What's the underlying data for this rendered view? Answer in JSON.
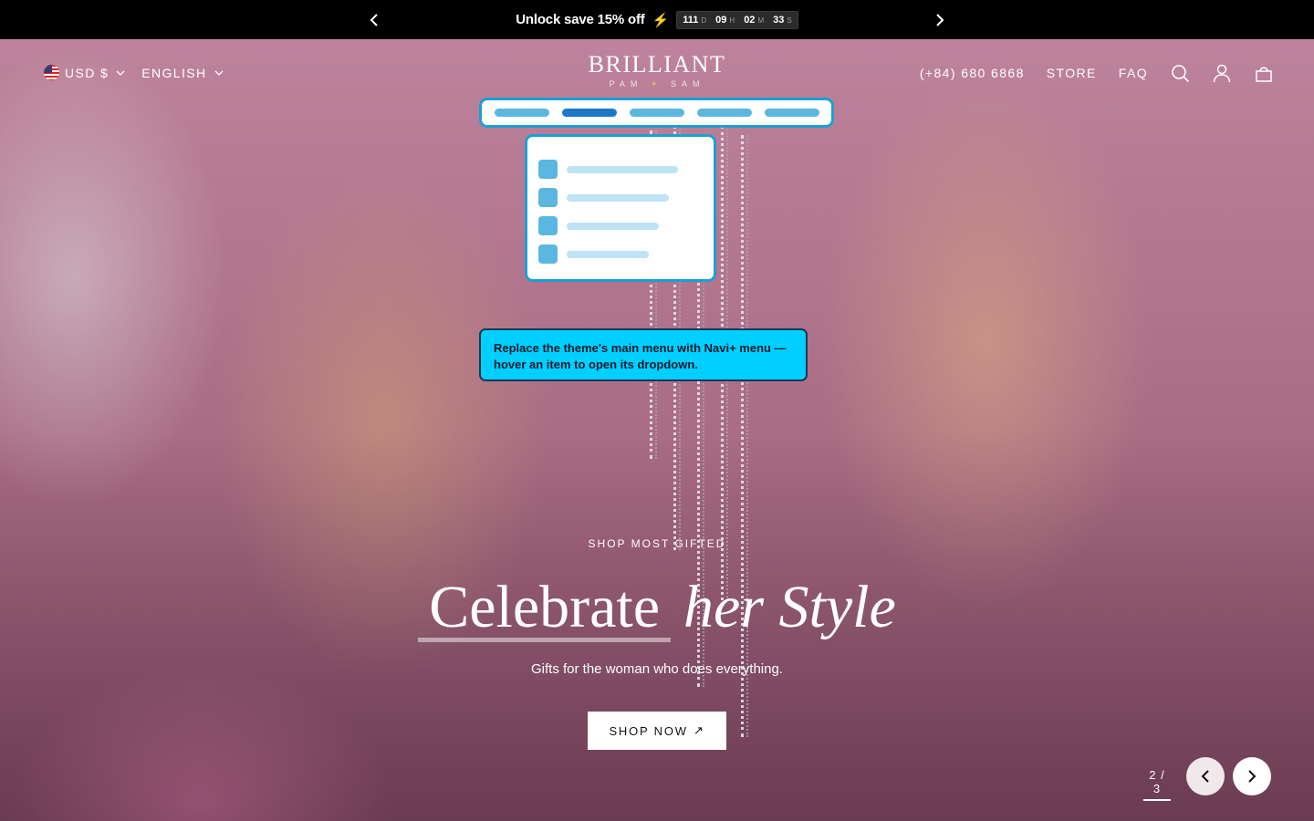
{
  "announcement": {
    "text": "Unlock save 15% off",
    "bolt": "⚡",
    "countdown": [
      {
        "value": "111",
        "unit": "D"
      },
      {
        "value": "09",
        "unit": "H"
      },
      {
        "value": "02",
        "unit": "M"
      },
      {
        "value": "33",
        "unit": "S"
      }
    ]
  },
  "header": {
    "currency": "USD $",
    "language": "ENGLISH",
    "logo_main": "BRILLIANT",
    "logo_sub_left": "PAM",
    "logo_sub_right": "SAM",
    "phone": "(+84) 680 6868",
    "store_label": "STORE",
    "faq_label": "FAQ",
    "icons": [
      "search-icon",
      "account-icon",
      "cart-icon"
    ]
  },
  "callout": {
    "text": "Replace the theme's main menu with Navi+ menu — hover an item to open its dropdown."
  },
  "hero": {
    "eyebrow": "SHOP MOST GIFTED",
    "title_plain": "Celebrate",
    "title_italic": "her Style",
    "subtitle": "Gifts for the woman who does everything.",
    "button_label": "SHOP NOW",
    "button_arrow": "↗"
  },
  "slider": {
    "current": 2,
    "total": 3,
    "label": "2 / 3"
  },
  "colors": {
    "announcement_bg": "#000000",
    "navi_border": "#1b9fd4",
    "navi_active": "#1b78c7",
    "navi_pill": "#5bb7e0",
    "callout_bg": "#00cfff"
  }
}
